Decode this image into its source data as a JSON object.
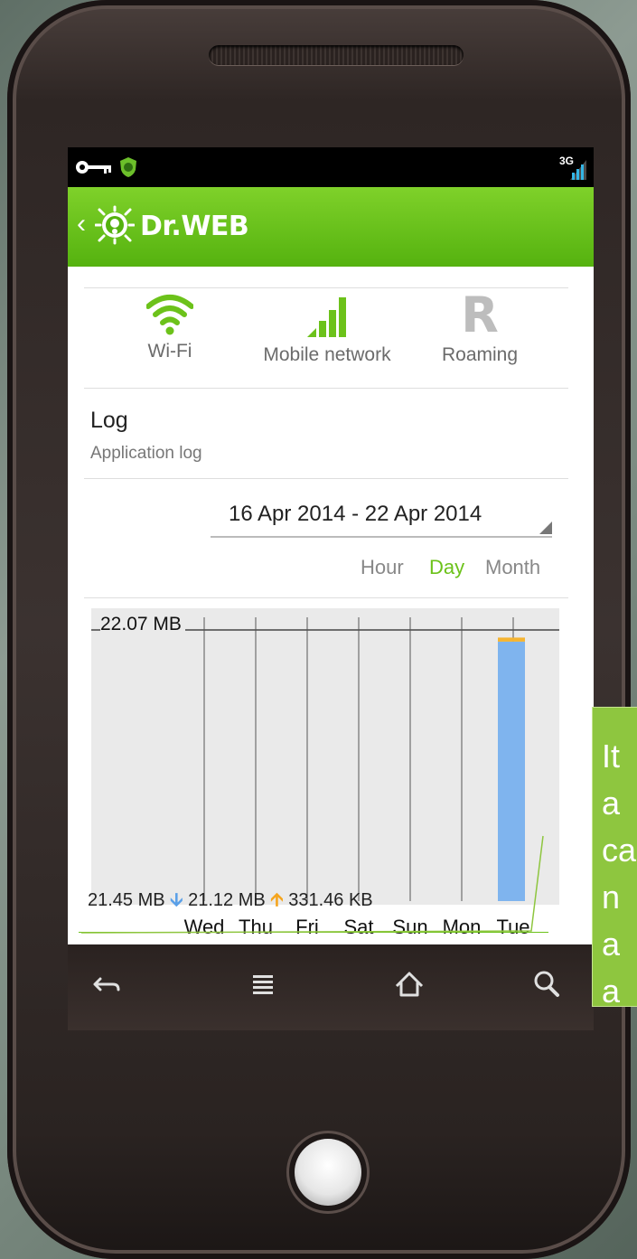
{
  "app": {
    "title": "Dr.WEB",
    "back_glyph": "‹"
  },
  "statusbar": {
    "network_type": "3G",
    "icons": [
      "key-icon",
      "drweb-shield-icon",
      "signal-icon"
    ]
  },
  "network_tabs": [
    {
      "label": "Wi-Fi",
      "icon": "wifi-icon",
      "color": "#6cc21a"
    },
    {
      "label": "Mobile network",
      "icon": "signal-bars-icon",
      "color": "#6cc21a"
    },
    {
      "label": "Roaming",
      "icon": "roaming-r-icon",
      "glyph": "R",
      "color": "#bdbdbd"
    }
  ],
  "log": {
    "title": "Log",
    "subtitle": "Application log"
  },
  "date_range": {
    "value": "16 Apr 2014 - 22 Apr 2014"
  },
  "periods": [
    {
      "label": "Hour",
      "active": false
    },
    {
      "label": "Day",
      "active": true
    },
    {
      "label": "Month",
      "active": false
    }
  ],
  "chart_data": {
    "type": "bar",
    "categories": [
      "Wed",
      "Thu",
      "Fri",
      "Sat",
      "Sun",
      "Mon",
      "Tue"
    ],
    "series": [
      {
        "values": [
          0,
          0,
          0,
          0,
          0,
          0,
          21.12
        ],
        "color": "#7fb4ee"
      },
      {
        "values": [
          0,
          0,
          0,
          0,
          0,
          0,
          0.33
        ],
        "color": "#f5b431"
      }
    ],
    "ylim": [
      0,
      22.07
    ],
    "ymax_label": "22.07 MB",
    "stacked": true
  },
  "totals": {
    "total": "21.45 MB",
    "received": "21.12 MB",
    "sent": "331.46 KB",
    "down_glyph": "🡫",
    "up_glyph": "🡩"
  },
  "softkeys": [
    "back-icon",
    "menu-icon",
    "home-icon",
    "search-icon"
  ],
  "callout": {
    "lines": [
      "It",
      "a",
      "ca",
      "n",
      "a",
      "a"
    ],
    "color": "#8ec63f"
  }
}
